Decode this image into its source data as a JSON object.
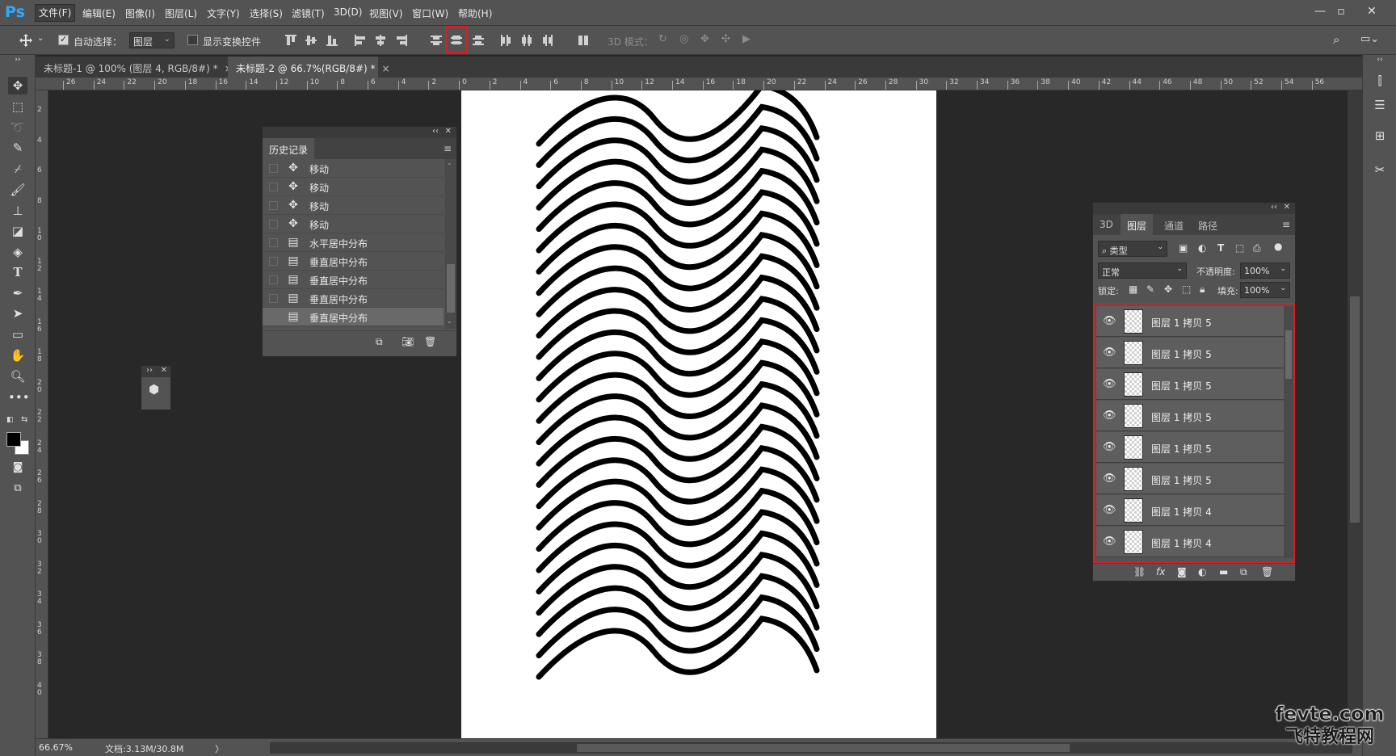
{
  "menubar": {
    "logo": "Ps",
    "items": [
      "文件(F)",
      "编辑(E)",
      "图像(I)",
      "图层(L)",
      "文字(Y)",
      "选择(S)",
      "滤镜(T)",
      "3D(D)",
      "视图(V)",
      "窗口(W)",
      "帮助(H)"
    ],
    "window_controls": [
      "—",
      "▫",
      "✕"
    ]
  },
  "options_bar": {
    "auto_select_label": "自动选择：",
    "auto_select_target": "图层",
    "show_transform_label": "显示变换控件",
    "mode_3d_label": "3D 模式："
  },
  "tabs": [
    {
      "title": "未标题-1 @ 100% (图层 4, RGB/8#) *"
    },
    {
      "title": "未标题-2 @ 66.7%(RGB/8#) *"
    }
  ],
  "rulers": {
    "top_ticks": [
      "26",
      "24",
      "22",
      "20",
      "18",
      "16",
      "14",
      "12",
      "10",
      "8",
      "6",
      "4",
      "2",
      "0",
      "2",
      "4",
      "6",
      "8",
      "10",
      "12",
      "14",
      "16",
      "18",
      "20",
      "22",
      "24",
      "26",
      "28",
      "30",
      "32",
      "34",
      "36",
      "38",
      "40",
      "42",
      "44",
      "46",
      "48",
      "50",
      "52",
      "54",
      "56"
    ],
    "left_ticks": [
      "2",
      "4",
      "6",
      "8",
      "1\n0",
      "1\n2",
      "1\n4",
      "1\n6",
      "1\n8",
      "2\n0",
      "2\n2",
      "2\n4",
      "2\n6",
      "2\n8",
      "3\n0",
      "3\n2",
      "3\n4",
      "3\n6",
      "3\n8",
      "4\n0"
    ]
  },
  "history_panel": {
    "tab": "历史记录",
    "rows": [
      {
        "icon": "move-icon",
        "label": "移动"
      },
      {
        "icon": "move-icon",
        "label": "移动"
      },
      {
        "icon": "move-icon",
        "label": "移动"
      },
      {
        "icon": "move-icon",
        "label": "移动"
      },
      {
        "icon": "document-icon",
        "label": "水平居中分布"
      },
      {
        "icon": "document-icon",
        "label": "垂直居中分布"
      },
      {
        "icon": "document-icon",
        "label": "垂直居中分布"
      },
      {
        "icon": "document-icon",
        "label": "垂直居中分布"
      },
      {
        "icon": "document-icon",
        "label": "垂直居中分布"
      }
    ]
  },
  "layers_panel": {
    "tabs": [
      "3D",
      "图层",
      "通道",
      "路径"
    ],
    "active_tab": "图层",
    "filter_kind": "类型",
    "blend_mode": "正常",
    "opacity_label": "不透明度:",
    "opacity_value": "100%",
    "lock_label": "锁定:",
    "fill_label": "填充:",
    "fill_value": "100%",
    "layers": [
      {
        "name": "图层 1 拷贝 5"
      },
      {
        "name": "图层 1 拷贝 5"
      },
      {
        "name": "图层 1 拷贝 5"
      },
      {
        "name": "图层 1 拷贝 5"
      },
      {
        "name": "图层 1 拷贝 5"
      },
      {
        "name": "图层 1 拷贝 5"
      },
      {
        "name": "图层 1 拷贝 4"
      },
      {
        "name": "图层 1 拷贝 4"
      }
    ]
  },
  "status": {
    "zoom": "66.67%",
    "doc_info": "文档:3.13M/30.8M",
    "arrow": "〉"
  },
  "watermark": {
    "line1": "fevte.com",
    "line2": "飞特教程网"
  },
  "colors": {
    "highlight": "#e01b24",
    "panel_bg": "#535353",
    "app_bg": "#282828"
  }
}
